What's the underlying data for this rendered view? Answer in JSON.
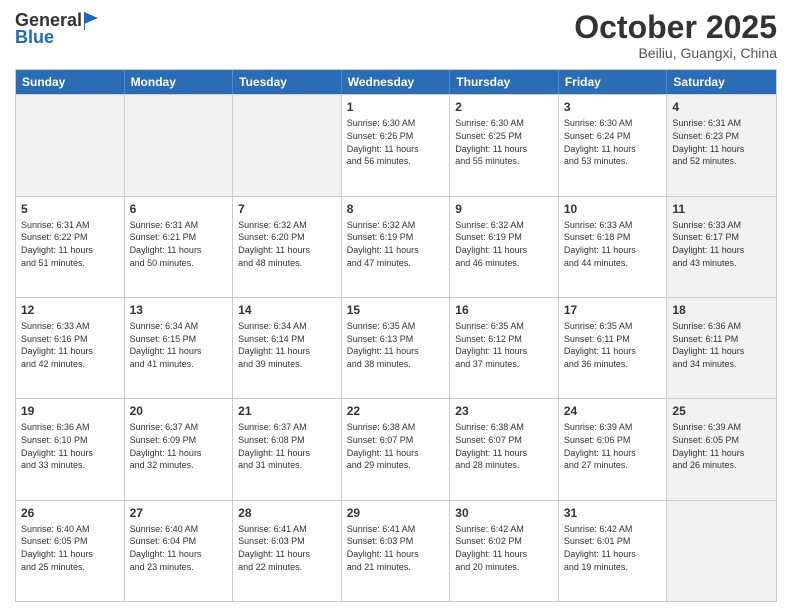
{
  "header": {
    "logo_line1": "General",
    "logo_line2": "Blue",
    "month": "October 2025",
    "location": "Beiliu, Guangxi, China"
  },
  "days_of_week": [
    "Sunday",
    "Monday",
    "Tuesday",
    "Wednesday",
    "Thursday",
    "Friday",
    "Saturday"
  ],
  "rows": [
    [
      {
        "day": "",
        "info": "",
        "shaded": true
      },
      {
        "day": "",
        "info": "",
        "shaded": true
      },
      {
        "day": "",
        "info": "",
        "shaded": true
      },
      {
        "day": "1",
        "info": "Sunrise: 6:30 AM\nSunset: 6:26 PM\nDaylight: 11 hours\nand 56 minutes."
      },
      {
        "day": "2",
        "info": "Sunrise: 6:30 AM\nSunset: 6:25 PM\nDaylight: 11 hours\nand 55 minutes."
      },
      {
        "day": "3",
        "info": "Sunrise: 6:30 AM\nSunset: 6:24 PM\nDaylight: 11 hours\nand 53 minutes."
      },
      {
        "day": "4",
        "info": "Sunrise: 6:31 AM\nSunset: 6:23 PM\nDaylight: 11 hours\nand 52 minutes.",
        "shaded": true
      }
    ],
    [
      {
        "day": "5",
        "info": "Sunrise: 6:31 AM\nSunset: 6:22 PM\nDaylight: 11 hours\nand 51 minutes."
      },
      {
        "day": "6",
        "info": "Sunrise: 6:31 AM\nSunset: 6:21 PM\nDaylight: 11 hours\nand 50 minutes."
      },
      {
        "day": "7",
        "info": "Sunrise: 6:32 AM\nSunset: 6:20 PM\nDaylight: 11 hours\nand 48 minutes."
      },
      {
        "day": "8",
        "info": "Sunrise: 6:32 AM\nSunset: 6:19 PM\nDaylight: 11 hours\nand 47 minutes."
      },
      {
        "day": "9",
        "info": "Sunrise: 6:32 AM\nSunset: 6:19 PM\nDaylight: 11 hours\nand 46 minutes."
      },
      {
        "day": "10",
        "info": "Sunrise: 6:33 AM\nSunset: 6:18 PM\nDaylight: 11 hours\nand 44 minutes."
      },
      {
        "day": "11",
        "info": "Sunrise: 6:33 AM\nSunset: 6:17 PM\nDaylight: 11 hours\nand 43 minutes.",
        "shaded": true
      }
    ],
    [
      {
        "day": "12",
        "info": "Sunrise: 6:33 AM\nSunset: 6:16 PM\nDaylight: 11 hours\nand 42 minutes."
      },
      {
        "day": "13",
        "info": "Sunrise: 6:34 AM\nSunset: 6:15 PM\nDaylight: 11 hours\nand 41 minutes."
      },
      {
        "day": "14",
        "info": "Sunrise: 6:34 AM\nSunset: 6:14 PM\nDaylight: 11 hours\nand 39 minutes."
      },
      {
        "day": "15",
        "info": "Sunrise: 6:35 AM\nSunset: 6:13 PM\nDaylight: 11 hours\nand 38 minutes."
      },
      {
        "day": "16",
        "info": "Sunrise: 6:35 AM\nSunset: 6:12 PM\nDaylight: 11 hours\nand 37 minutes."
      },
      {
        "day": "17",
        "info": "Sunrise: 6:35 AM\nSunset: 6:11 PM\nDaylight: 11 hours\nand 36 minutes."
      },
      {
        "day": "18",
        "info": "Sunrise: 6:36 AM\nSunset: 6:11 PM\nDaylight: 11 hours\nand 34 minutes.",
        "shaded": true
      }
    ],
    [
      {
        "day": "19",
        "info": "Sunrise: 6:36 AM\nSunset: 6:10 PM\nDaylight: 11 hours\nand 33 minutes."
      },
      {
        "day": "20",
        "info": "Sunrise: 6:37 AM\nSunset: 6:09 PM\nDaylight: 11 hours\nand 32 minutes."
      },
      {
        "day": "21",
        "info": "Sunrise: 6:37 AM\nSunset: 6:08 PM\nDaylight: 11 hours\nand 31 minutes."
      },
      {
        "day": "22",
        "info": "Sunrise: 6:38 AM\nSunset: 6:07 PM\nDaylight: 11 hours\nand 29 minutes."
      },
      {
        "day": "23",
        "info": "Sunrise: 6:38 AM\nSunset: 6:07 PM\nDaylight: 11 hours\nand 28 minutes."
      },
      {
        "day": "24",
        "info": "Sunrise: 6:39 AM\nSunset: 6:06 PM\nDaylight: 11 hours\nand 27 minutes."
      },
      {
        "day": "25",
        "info": "Sunrise: 6:39 AM\nSunset: 6:05 PM\nDaylight: 11 hours\nand 26 minutes.",
        "shaded": true
      }
    ],
    [
      {
        "day": "26",
        "info": "Sunrise: 6:40 AM\nSunset: 6:05 PM\nDaylight: 11 hours\nand 25 minutes."
      },
      {
        "day": "27",
        "info": "Sunrise: 6:40 AM\nSunset: 6:04 PM\nDaylight: 11 hours\nand 23 minutes."
      },
      {
        "day": "28",
        "info": "Sunrise: 6:41 AM\nSunset: 6:03 PM\nDaylight: 11 hours\nand 22 minutes."
      },
      {
        "day": "29",
        "info": "Sunrise: 6:41 AM\nSunset: 6:03 PM\nDaylight: 11 hours\nand 21 minutes."
      },
      {
        "day": "30",
        "info": "Sunrise: 6:42 AM\nSunset: 6:02 PM\nDaylight: 11 hours\nand 20 minutes."
      },
      {
        "day": "31",
        "info": "Sunrise: 6:42 AM\nSunset: 6:01 PM\nDaylight: 11 hours\nand 19 minutes."
      },
      {
        "day": "",
        "info": "",
        "shaded": true
      }
    ]
  ]
}
